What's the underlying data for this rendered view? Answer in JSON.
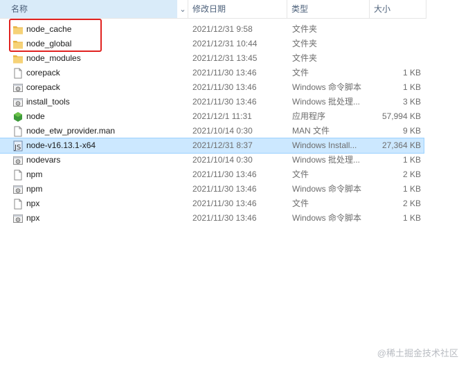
{
  "columns": {
    "name": "名称",
    "date": "修改日期",
    "type": "类型",
    "size": "大小"
  },
  "files": [
    {
      "name": "node_cache",
      "date": "2021/12/31 9:58",
      "type": "文件夹",
      "size": "",
      "icon": "folder-icon",
      "selected": false
    },
    {
      "name": "node_global",
      "date": "2021/12/31 10:44",
      "type": "文件夹",
      "size": "",
      "icon": "folder-icon",
      "selected": false
    },
    {
      "name": "node_modules",
      "date": "2021/12/31 13:45",
      "type": "文件夹",
      "size": "",
      "icon": "folder-icon",
      "selected": false
    },
    {
      "name": "corepack",
      "date": "2021/11/30 13:46",
      "type": "文件",
      "size": "1 KB",
      "icon": "file-icon",
      "selected": false
    },
    {
      "name": "corepack",
      "date": "2021/11/30 13:46",
      "type": "Windows 命令脚本",
      "size": "1 KB",
      "icon": "script-icon",
      "selected": false
    },
    {
      "name": "install_tools",
      "date": "2021/11/30 13:46",
      "type": "Windows 批处理...",
      "size": "3 KB",
      "icon": "script-icon",
      "selected": false
    },
    {
      "name": "node",
      "date": "2021/12/1 11:31",
      "type": "应用程序",
      "size": "57,994 KB",
      "icon": "node-app-icon",
      "selected": false
    },
    {
      "name": "node_etw_provider.man",
      "date": "2021/10/14 0:30",
      "type": "MAN 文件",
      "size": "9 KB",
      "icon": "file-icon",
      "selected": false
    },
    {
      "name": "node-v16.13.1-x64",
      "date": "2021/12/31 8:37",
      "type": "Windows Install...",
      "size": "27,364 KB",
      "icon": "installer-icon",
      "selected": true
    },
    {
      "name": "nodevars",
      "date": "2021/10/14 0:30",
      "type": "Windows 批处理...",
      "size": "1 KB",
      "icon": "script-icon",
      "selected": false
    },
    {
      "name": "npm",
      "date": "2021/11/30 13:46",
      "type": "文件",
      "size": "2 KB",
      "icon": "file-icon",
      "selected": false
    },
    {
      "name": "npm",
      "date": "2021/11/30 13:46",
      "type": "Windows 命令脚本",
      "size": "1 KB",
      "icon": "script-icon",
      "selected": false
    },
    {
      "name": "npx",
      "date": "2021/11/30 13:46",
      "type": "文件",
      "size": "2 KB",
      "icon": "file-icon",
      "selected": false
    },
    {
      "name": "npx",
      "date": "2021/11/30 13:46",
      "type": "Windows 命令脚本",
      "size": "1 KB",
      "icon": "script-icon",
      "selected": false
    }
  ],
  "watermark": "@稀土掘金技术社区",
  "colors": {
    "highlight": "#e0211f",
    "selection": "#cce8ff",
    "folder": "#f2c75c",
    "node_green": "#3d9a3a"
  }
}
